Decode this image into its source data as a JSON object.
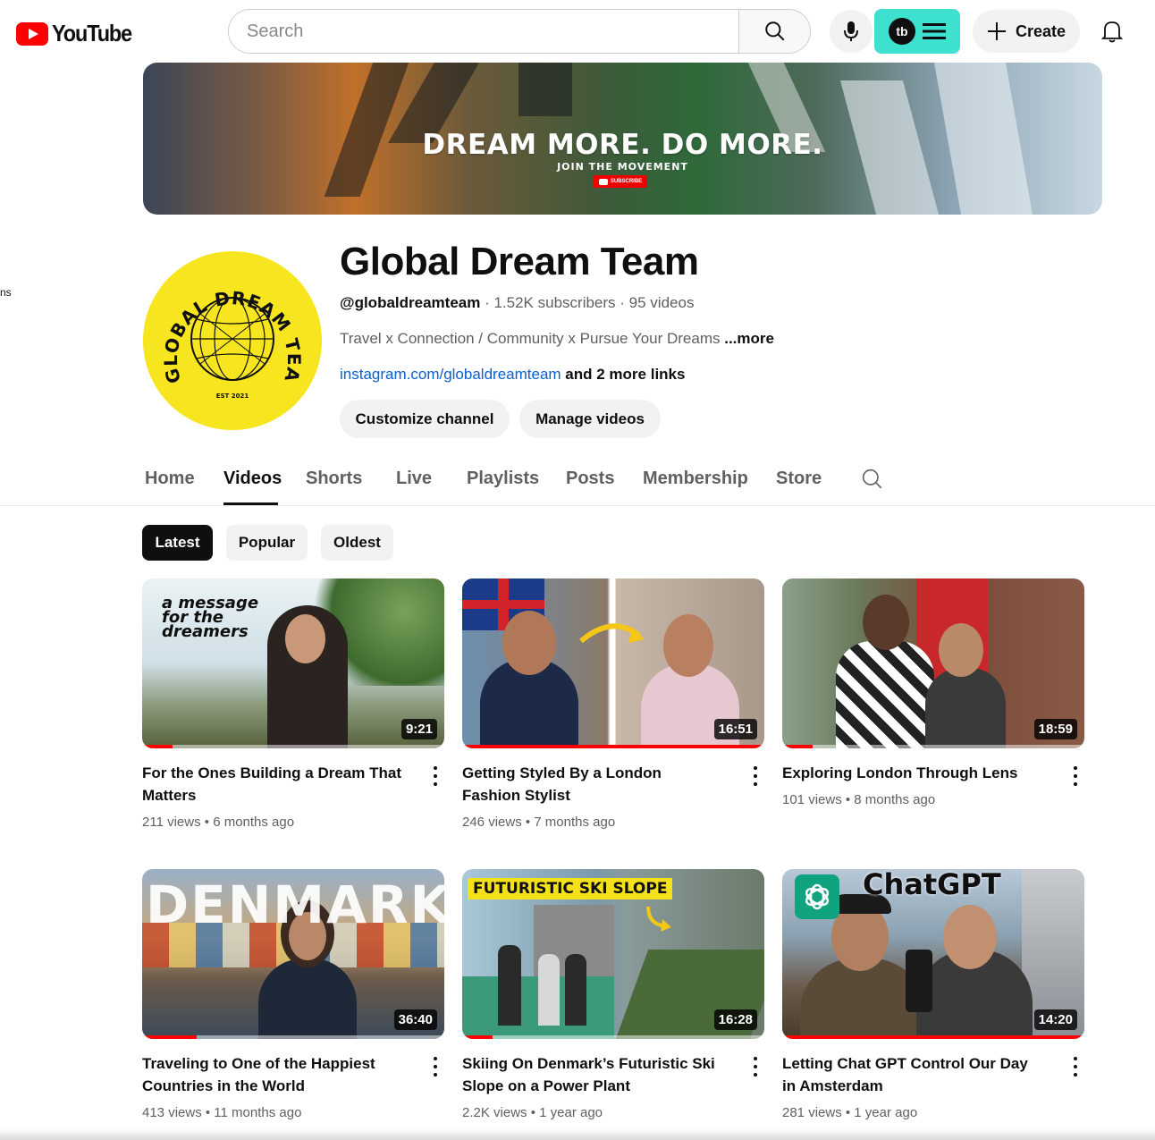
{
  "header": {
    "logo_text": "YouTube",
    "search_placeholder": "Search",
    "create_label": "Create"
  },
  "sidebar_fragment": "ns",
  "banner": {
    "title": "DREAM MORE. DO MORE.",
    "subtitle": "JOIN THE MOVEMENT",
    "subscribe_label": "SUBSCRIBE"
  },
  "channel": {
    "name": "Global Dream Team",
    "handle": "@globaldreamteam",
    "subscribers": "1.52K subscribers",
    "videos_count": "95 videos",
    "description": "Travel x Connection / Community x Pursue Your Dreams",
    "more_label": "...more",
    "link": "instagram.com/globaldreamteam",
    "more_links": "and 2 more links",
    "avatar_text_top": "GLOBAL DREAM TEAM",
    "avatar_est": "EST 2021",
    "customize_label": "Customize channel",
    "manage_label": "Manage videos"
  },
  "tabs": [
    "Home",
    "Videos",
    "Shorts",
    "Live",
    "Playlists",
    "Posts",
    "Membership",
    "Store"
  ],
  "active_tab": "Videos",
  "chips": [
    "Latest",
    "Popular",
    "Oldest"
  ],
  "active_chip": "Latest",
  "videos": [
    {
      "title": "For the Ones Building a Dream That Matters",
      "views": "211 views",
      "age": "6 months ago",
      "duration": "9:21",
      "watched_fraction": 0.1,
      "thumb_text": "a message for the dreamers"
    },
    {
      "title": "Getting Styled By a London Fashion Stylist",
      "views": "246 views",
      "age": "7 months ago",
      "duration": "16:51",
      "watched_fraction": 1.0
    },
    {
      "title": "Exploring London Through Lens",
      "views": "101 views",
      "age": "8 months ago",
      "duration": "18:59",
      "watched_fraction": 0.1
    },
    {
      "title": "Traveling to One of the Happiest Countries in the World",
      "views": "413 views",
      "age": "11 months ago",
      "duration": "36:40",
      "watched_fraction": 0.18,
      "thumb_text": "DENMARK"
    },
    {
      "title": "Skiing On Denmark’s Futuristic Ski Slope on a Power Plant",
      "views": "2.2K views",
      "age": "1 year ago",
      "duration": "16:28",
      "watched_fraction": 0.1,
      "thumb_text": "FUTURISTIC SKI SLOPE"
    },
    {
      "title": "Letting Chat GPT Control Our Day in Amsterdam",
      "views": "281 views",
      "age": "1 year ago",
      "duration": "14:20",
      "watched_fraction": 1.0,
      "thumb_text": "ChatGPT"
    }
  ],
  "colors": {
    "accent": "#ff0000",
    "link": "#065fd4",
    "tubebuddy": "#3ee0d0",
    "avatar_bg": "#f7e51f"
  }
}
